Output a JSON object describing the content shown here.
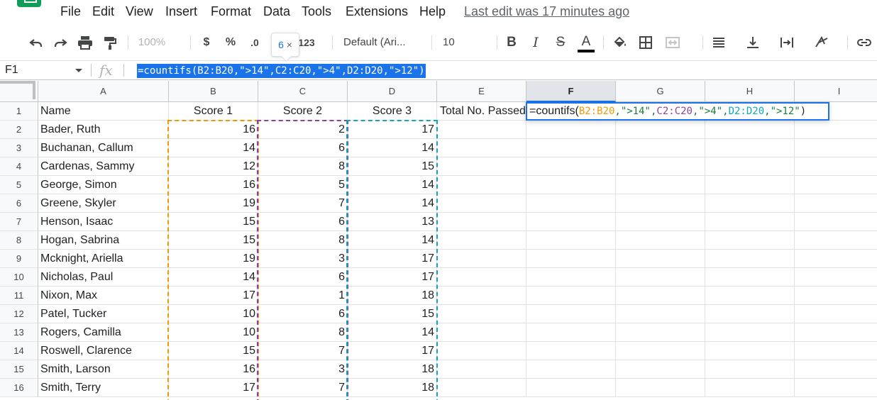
{
  "menu": {
    "items": [
      "File",
      "Edit",
      "View",
      "Insert",
      "Format",
      "Data",
      "Tools",
      "Extensions",
      "Help"
    ],
    "last_edit": "Last edit was 17 minutes ago"
  },
  "toolbar": {
    "zoom": "100%",
    "currency": "$",
    "percent": "%",
    "decrease_decimal": ".0",
    "more_formats": "123",
    "font": "Default (Ari...",
    "font_size": "10",
    "bold": "B",
    "italic": "I",
    "strike": "S",
    "text_color": "A"
  },
  "tooltip": {
    "value": "6",
    "close": "×"
  },
  "formula_bar": {
    "name_box": "F1",
    "fx": "fx",
    "formula": "=countifs(B2:B20,\">14\",C2:C20,\">4\",D2:D20,\">12\")"
  },
  "edit_cell": {
    "func": "=countifs(",
    "range1": "B2:B20",
    "crit1": ",\">14\",",
    "range2": "C2:C20",
    "crit2": ",\">4\",",
    "range3": "D2:D20",
    "crit3": ",\">12\"",
    "close": ")"
  },
  "colors": {
    "range1": "#f29900",
    "range2": "#8e3fa2",
    "range3": "#12a4c3",
    "selection": "#1a73e8",
    "string": "#188038"
  },
  "columns": [
    "A",
    "B",
    "C",
    "D",
    "E",
    "F",
    "G",
    "H",
    "I"
  ],
  "header_row": {
    "a": "Name",
    "b": "Score 1",
    "c": "Score 2",
    "d": "Score 3",
    "e": "Total No. Passed"
  },
  "rows": [
    {
      "n": "2",
      "a": "Bader, Ruth",
      "b": "16",
      "c": "2",
      "d": "17"
    },
    {
      "n": "3",
      "a": "Buchanan, Callum",
      "b": "14",
      "c": "6",
      "d": "14"
    },
    {
      "n": "4",
      "a": "Cardenas, Sammy",
      "b": "12",
      "c": "8",
      "d": "15"
    },
    {
      "n": "5",
      "a": "George, Simon",
      "b": "16",
      "c": "5",
      "d": "14"
    },
    {
      "n": "6",
      "a": "Greene, Skyler",
      "b": "19",
      "c": "7",
      "d": "14"
    },
    {
      "n": "7",
      "a": "Henson, Isaac",
      "b": "15",
      "c": "6",
      "d": "13"
    },
    {
      "n": "8",
      "a": "Hogan, Sabrina",
      "b": "15",
      "c": "8",
      "d": "14"
    },
    {
      "n": "9",
      "a": "Mcknight, Ariella",
      "b": "19",
      "c": "3",
      "d": "17"
    },
    {
      "n": "10",
      "a": "Nicholas, Paul",
      "b": "14",
      "c": "6",
      "d": "17"
    },
    {
      "n": "11",
      "a": "Nixon, Max",
      "b": "17",
      "c": "1",
      "d": "18"
    },
    {
      "n": "12",
      "a": "Patel, Tucker",
      "b": "10",
      "c": "6",
      "d": "15"
    },
    {
      "n": "13",
      "a": "Rogers, Camilla",
      "b": "10",
      "c": "8",
      "d": "14"
    },
    {
      "n": "14",
      "a": "Roswell, Clarence",
      "b": "15",
      "c": "7",
      "d": "17"
    },
    {
      "n": "15",
      "a": "Smith, Larson",
      "b": "16",
      "c": "3",
      "d": "18"
    },
    {
      "n": "16",
      "a": "Smith, Terry",
      "b": "17",
      "c": "7",
      "d": "18"
    }
  ]
}
